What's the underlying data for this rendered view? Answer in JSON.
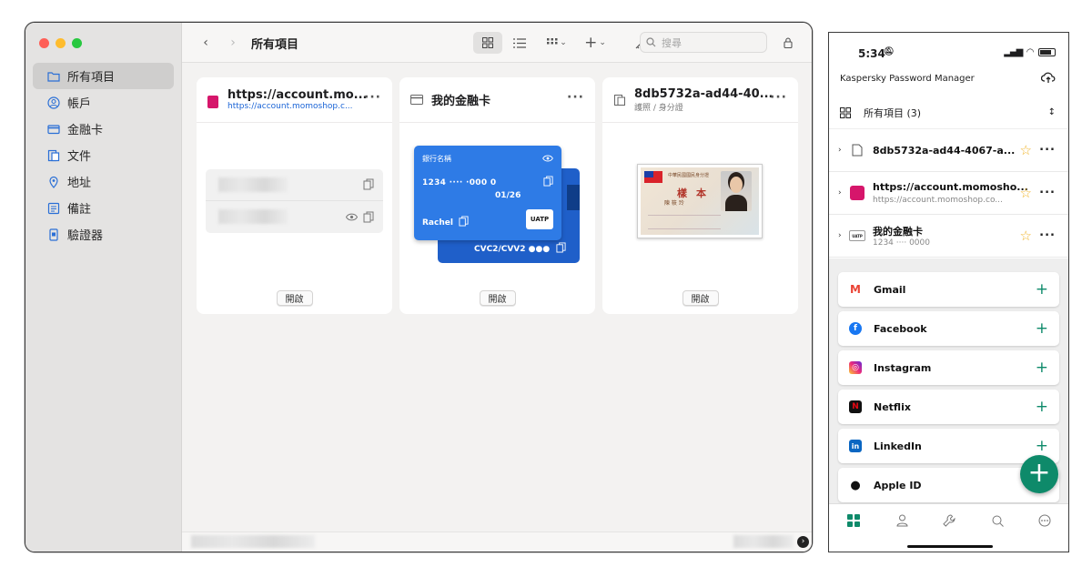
{
  "mac": {
    "toolbar": {
      "title": "所有項目",
      "search_placeholder": "搜尋"
    },
    "sidebar": {
      "items": [
        {
          "label": "所有項目",
          "icon": "folder-icon",
          "active": true
        },
        {
          "label": "帳戶",
          "icon": "person-circle-icon"
        },
        {
          "label": "金融卡",
          "icon": "credit-card-icon"
        },
        {
          "label": "文件",
          "icon": "document-icon"
        },
        {
          "label": "地址",
          "icon": "location-pin-icon"
        },
        {
          "label": "備註",
          "icon": "note-icon"
        },
        {
          "label": "驗證器",
          "icon": "authenticator-icon"
        }
      ]
    },
    "cards": [
      {
        "title": "https://account.mo...",
        "subtitle": "https://account.momoshop.c...",
        "open": "開啟",
        "icon": "momo-logo-icon"
      },
      {
        "title": "我的金融卡",
        "open": "開啟",
        "icon": "credit-card-icon",
        "card": {
          "bank": "銀行名稱",
          "number": "1234 ···· ·000 0",
          "expiry": "01/26",
          "name": "Rachel",
          "network": "UATP",
          "cvc": "CVC2/CVV2 ●●●"
        }
      },
      {
        "title": "8db5732a-ad44-40...",
        "subtitle": "護照 / 身分證",
        "open": "開啟",
        "icon": "id-document-icon",
        "id_card": {
          "header": "中華民國國民身分證",
          "stamp": "樣本",
          "name": "陳 筱 玲"
        }
      }
    ]
  },
  "phone": {
    "status": {
      "time": "5:34"
    },
    "app_title": "Kaspersky Password Manager",
    "filter": "所有項目 (3)",
    "entries": [
      {
        "title": "8db5732a-ad44-4067-a...",
        "subtitle": "",
        "icon": "document-icon"
      },
      {
        "title": "https://account.momosho...",
        "subtitle": "https://account.momoshop.co...",
        "icon": "momo-logo-icon"
      },
      {
        "title": "我的金融卡",
        "subtitle": "1234 ···· 0000",
        "icon": "uatp-card-icon"
      }
    ],
    "services": [
      {
        "label": "Gmail",
        "icon": "gmail-icon",
        "color": "#ea4335"
      },
      {
        "label": "Facebook",
        "icon": "facebook-icon",
        "color": "#1877f2"
      },
      {
        "label": "Instagram",
        "icon": "instagram-icon",
        "color": "#e1306c"
      },
      {
        "label": "Netflix",
        "icon": "netflix-icon",
        "color": "#e50914"
      },
      {
        "label": "LinkedIn",
        "icon": "linkedin-icon",
        "color": "#0a66c2"
      },
      {
        "label": "Apple ID",
        "icon": "apple-icon",
        "color": "#111111"
      }
    ],
    "accent": "#0e8a6a"
  }
}
